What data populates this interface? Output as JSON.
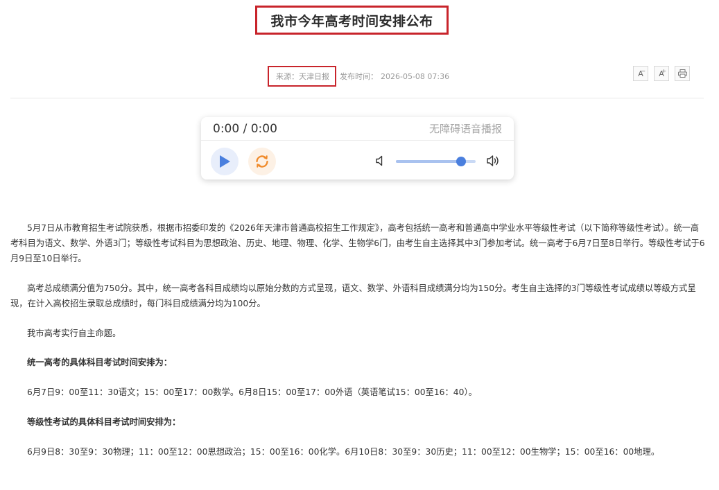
{
  "title": "我市今年高考时间安排公布",
  "meta": {
    "source": "来源：天津日报",
    "pubtime_label": "发布时间：",
    "pubtime": "2026-05-08 07:36"
  },
  "tools": {
    "font_smaller": "A",
    "font_larger": "A",
    "smaller_sup": "−",
    "larger_sup": "+"
  },
  "player": {
    "time": "0:00 / 0:00",
    "label": "无障碍语音播报",
    "volume": 0.82,
    "accent": "#4a7fde"
  },
  "article": {
    "p1": "5月7日从市教育招生考试院获悉，根据市招委印发的《2026年天津市普通高校招生工作规定》，高考包括统一高考和普通高中学业水平等级性考试（以下简称等级性考试）。统一高考科目为语文、数学、外语3门；等级性考试科目为思想政治、历史、地理、物理、化学、生物学6门，由考生自主选择其中3门参加考试。统一高考于6月7日至8日举行。等级性考试于6月9日至10日举行。",
    "p2": "高考总成绩满分值为750分。其中，统一高考各科目成绩均以原始分数的方式呈现，语文、数学、外语科目成绩满分均为150分。考生自主选择的3门等级性考试成绩以等级方式呈现，在计入高校招生录取总成绩时，每门科目成绩满分均为100分。",
    "p3": "我市高考实行自主命题。",
    "h1": "统一高考的具体科目考试时间安排为：",
    "p4": "6月7日9：00至11：30语文；15：00至17：00数学。6月8日15：00至17：00外语（英语笔试15：00至16：40）。",
    "h2": "等级性考试的具体科目考试时间安排为：",
    "p5": "6月9日8：30至9：30物理；11：00至12：00思想政治；15：00至16：00化学。6月10日8：30至9：30历史；11：00至12：00生物学；15：00至16：00地理。"
  }
}
